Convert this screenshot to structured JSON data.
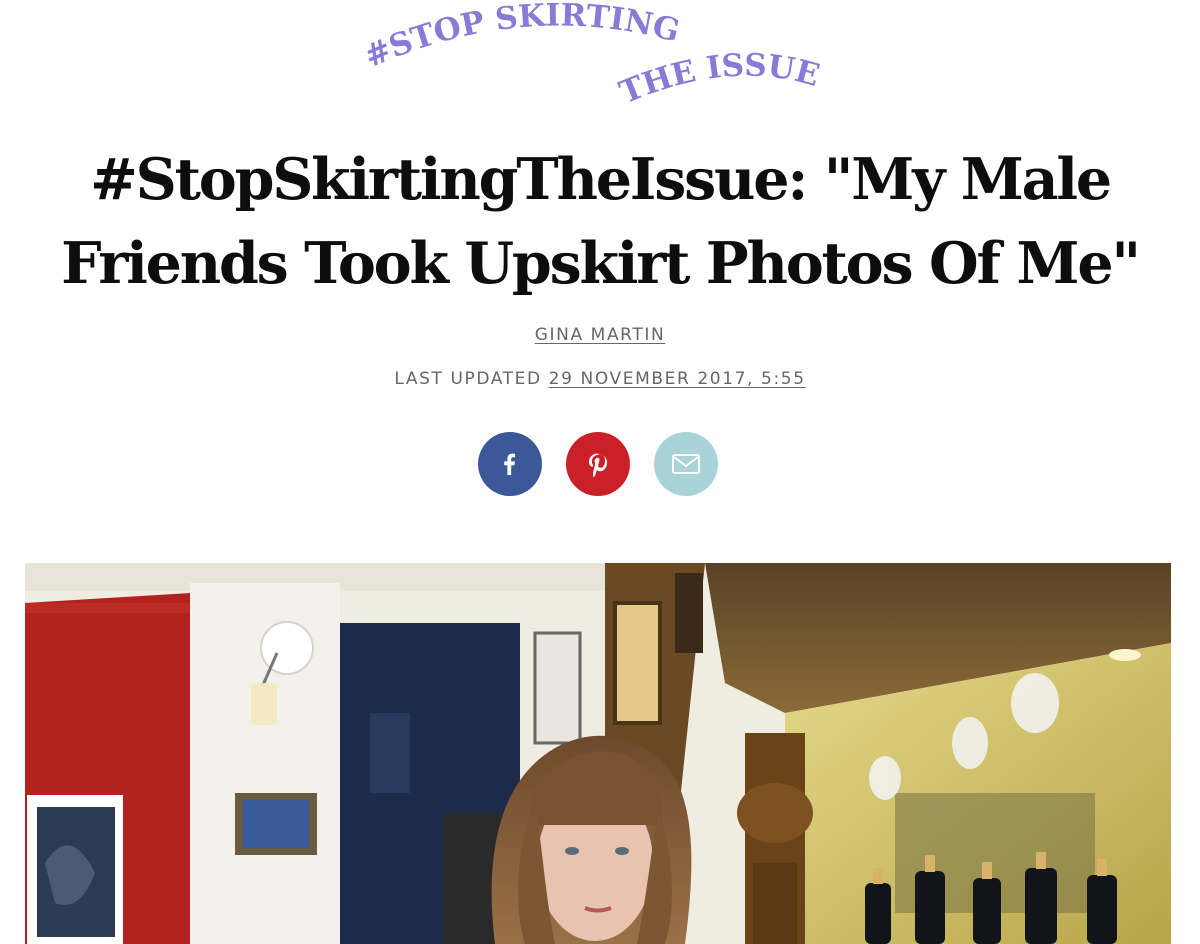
{
  "campaign_logo": {
    "line1": "#STOP SKIRTING",
    "line2": "THE ISSUE",
    "color": "#8a79d6"
  },
  "article": {
    "title": "#StopSkirtingTheIssue: \"My Male Friends Took Upskirt Photos Of Me\"",
    "author": "GINA MARTIN",
    "updated_label": "LAST UPDATED",
    "updated_date": "29 NOVEMBER 2017, 5:55"
  },
  "share": {
    "buttons": [
      {
        "network": "facebook",
        "icon": "facebook-icon",
        "color": "#3b5998"
      },
      {
        "network": "pinterest",
        "icon": "pinterest-icon",
        "color": "#cb2027"
      },
      {
        "network": "email",
        "icon": "mail-icon",
        "color": "#a9d3d6"
      }
    ]
  },
  "hero_image": {
    "subject": "woman with long brown hair and a fringe standing at a pub bar with beer taps"
  }
}
